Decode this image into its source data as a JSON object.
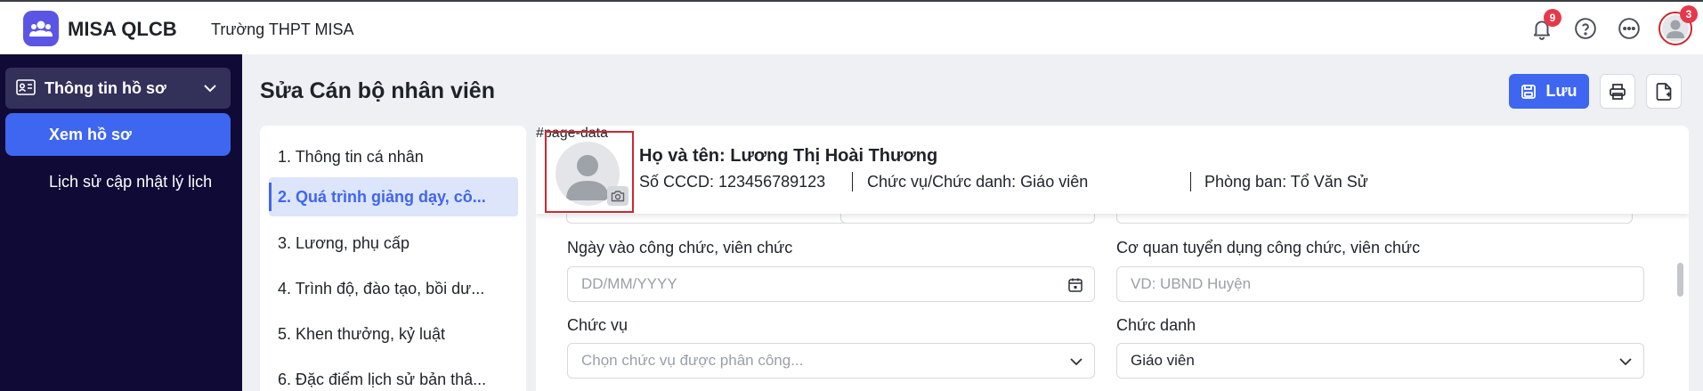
{
  "app": {
    "name": "MISA QLCB",
    "school": "Trường THPT MISA"
  },
  "topbar": {
    "notification_count": "9",
    "profile_badge": "3",
    "icons": [
      "bell-icon",
      "help-icon",
      "more-icon",
      "user-avatar-icon"
    ]
  },
  "sidebar": {
    "group_label": "Thông tin hồ sơ",
    "items": [
      {
        "label": "Xem hồ sơ",
        "active": true
      },
      {
        "label": "Lịch sử cập nhật lý lịch",
        "active": false
      }
    ]
  },
  "page": {
    "title": "Sửa Cán bộ nhân viên",
    "save_label": "Lưu"
  },
  "nav": {
    "items": [
      {
        "label": "1. Thông tin cá nhân"
      },
      {
        "label": "2. Quá trình giảng dạy, cô..."
      },
      {
        "label": "3. Lương, phụ cấp"
      },
      {
        "label": "4. Trình độ, đào tạo, bồi dư..."
      },
      {
        "label": "5. Khen thưởng, kỷ luật"
      },
      {
        "label": "6. Đặc điểm lịch sử bản thâ..."
      }
    ]
  },
  "profile": {
    "name_line": "Họ và tên: Lương Thị Hoài Thương",
    "cccd": "Số CCCD: 123456789123",
    "position": "Chức vụ/Chức danh: Giáo viên",
    "department": "Phòng ban: Tổ Văn Sử"
  },
  "form": {
    "start_date_label": "Ngày vào công chức, viên chức",
    "start_date_placeholder": "DD/MM/YYYY",
    "agency_label": "Cơ quan tuyển dụng công chức, viên chức",
    "agency_placeholder": "VD: UBND Huyện",
    "chuc_vu_label": "Chức vụ",
    "chuc_vu_placeholder": "Chọn chức vụ được phân công...",
    "chuc_danh_label": "Chức danh",
    "chuc_danh_value": "Giáo viên"
  },
  "colors": {
    "primary": "#3f66f0",
    "sidebar_bg": "#0f0b36",
    "badge": "#e5394b",
    "avatar_outline": "#d0262f"
  }
}
